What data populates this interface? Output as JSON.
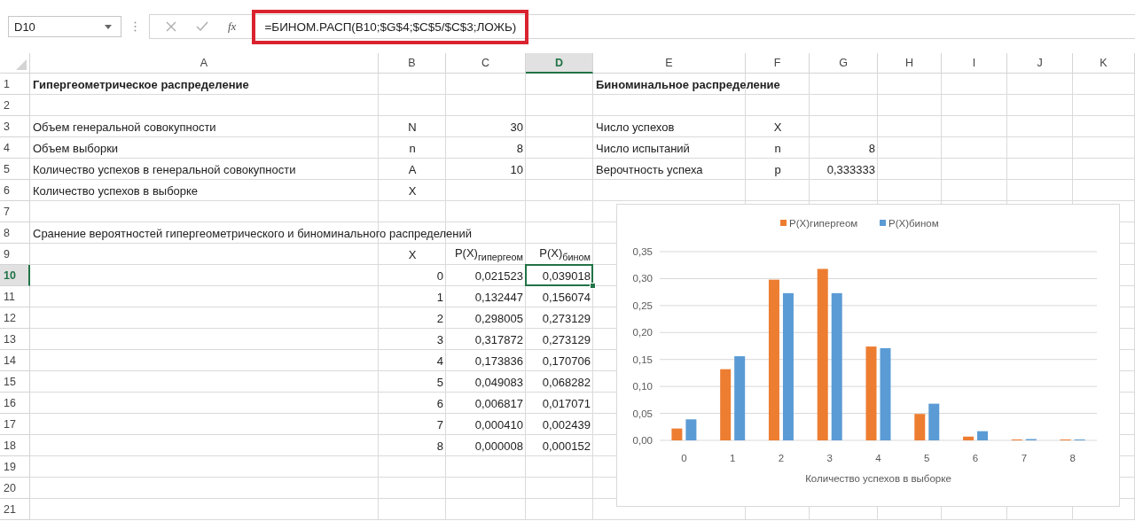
{
  "formula_bar": {
    "name_box": "D10",
    "fx": "fx",
    "formula": "=БИНОМ.РАСП(B10;$G$4;$C$5/$C$3;ЛОЖЬ)",
    "highlighted": true
  },
  "columns": [
    {
      "label": "A",
      "selected": false
    },
    {
      "label": "B",
      "selected": false
    },
    {
      "label": "C",
      "selected": false
    },
    {
      "label": "D",
      "selected": true
    },
    {
      "label": "E",
      "selected": false
    },
    {
      "label": "F",
      "selected": false
    },
    {
      "label": "G",
      "selected": false
    },
    {
      "label": "H",
      "selected": false
    },
    {
      "label": "I",
      "selected": false
    },
    {
      "label": "J",
      "selected": false
    },
    {
      "label": "K",
      "selected": false
    }
  ],
  "rows": [
    {
      "label": "1",
      "selected": false,
      "bold": true,
      "cells": [
        "Гипергеометрическое распределение",
        null,
        null,
        null,
        "Биноминальное распределение"
      ]
    },
    {
      "label": "2",
      "selected": false,
      "cells": []
    },
    {
      "label": "3",
      "selected": false,
      "bold": false,
      "cells": [
        "Объем генеральной совокупности",
        "N",
        "30",
        null,
        "Число успехов",
        "X"
      ]
    },
    {
      "label": "4",
      "selected": false,
      "bold": false,
      "cells": [
        "Объем выборки",
        "n",
        "8",
        null,
        "Число испытаний",
        "n",
        "8"
      ]
    },
    {
      "label": "5",
      "selected": false,
      "bold": false,
      "cells": [
        "Количество успехов в генеральной совокупности",
        "A",
        "10",
        null,
        "Верочтность успеха",
        "p",
        "0,333333"
      ]
    },
    {
      "label": "6",
      "selected": false,
      "bold": false,
      "cells": [
        "Количество успехов в выборке",
        "X"
      ]
    },
    {
      "label": "7",
      "selected": false,
      "cells": []
    },
    {
      "label": "8",
      "selected": false,
      "bold": false,
      "cells": [
        "Сранение вероятностей гипергеометрического и биноминального распределений"
      ]
    },
    {
      "label": "9",
      "selected": false,
      "bold": false,
      "cells": [
        null,
        "X",
        "P(X)$_{гипергеом}$",
        "P(X)$_{бином}$"
      ]
    },
    {
      "label": "10",
      "selected": true,
      "bold": false,
      "cells": [
        null,
        "0",
        "0,021523",
        "0,039018"
      ]
    },
    {
      "label": "11",
      "selected": false,
      "bold": false,
      "cells": [
        null,
        "1",
        "0,132447",
        "0,156074"
      ]
    },
    {
      "label": "12",
      "selected": false,
      "bold": false,
      "cells": [
        null,
        "2",
        "0,298005",
        "0,273129"
      ]
    },
    {
      "label": "13",
      "selected": false,
      "bold": false,
      "cells": [
        null,
        "3",
        "0,317872",
        "0,273129"
      ]
    },
    {
      "label": "14",
      "selected": false,
      "bold": false,
      "cells": [
        null,
        "4",
        "0,173836",
        "0,170706"
      ]
    },
    {
      "label": "15",
      "selected": false,
      "bold": false,
      "cells": [
        null,
        "5",
        "0,049083",
        "0,068282"
      ]
    },
    {
      "label": "16",
      "selected": false,
      "bold": false,
      "cells": [
        null,
        "6",
        "0,006817",
        "0,017071"
      ]
    },
    {
      "label": "17",
      "selected": false,
      "bold": false,
      "cells": [
        null,
        "7",
        "0,000410",
        "0,002439"
      ]
    },
    {
      "label": "18",
      "selected": false,
      "bold": false,
      "cells": [
        null,
        "8",
        "0,000008",
        "0,000152"
      ]
    },
    {
      "label": "19",
      "selected": false,
      "cells": []
    },
    {
      "label": "20",
      "selected": false,
      "cells": []
    },
    {
      "label": "21",
      "selected": false,
      "cells": []
    }
  ],
  "chart": {
    "chart_data": {
      "type": "bar",
      "grid": true,
      "legend": "top",
      "xlabel": "Количество успехов в выборке",
      "categories": [
        "0",
        "1",
        "2",
        "3",
        "4",
        "5",
        "6",
        "7",
        "8"
      ],
      "series": [
        {
          "name": "P(X)гипергеом",
          "color": "#ed7d31",
          "values": [
            0.022,
            0.132,
            0.298,
            0.318,
            0.174,
            0.049,
            0.007,
            0.0004,
            1e-05
          ]
        },
        {
          "name": "P(X)бином",
          "color": "#5b9bd5",
          "values": [
            0.039,
            0.156,
            0.273,
            0.273,
            0.171,
            0.068,
            0.017,
            0.0024,
            0.0002
          ]
        }
      ],
      "ylim": [
        0,
        0.35
      ],
      "yticks": [
        {
          "value": 0,
          "label": "0,00"
        },
        {
          "value": 0.05,
          "label": "0,05"
        },
        {
          "value": 0.1,
          "label": "0,10"
        },
        {
          "value": 0.15,
          "label": "0,15"
        },
        {
          "value": 0.2,
          "label": "0,20"
        },
        {
          "value": 0.25,
          "label": "0,25"
        },
        {
          "value": 0.3,
          "label": "0,30"
        },
        {
          "value": 0.35,
          "label": "0,35"
        }
      ]
    }
  }
}
